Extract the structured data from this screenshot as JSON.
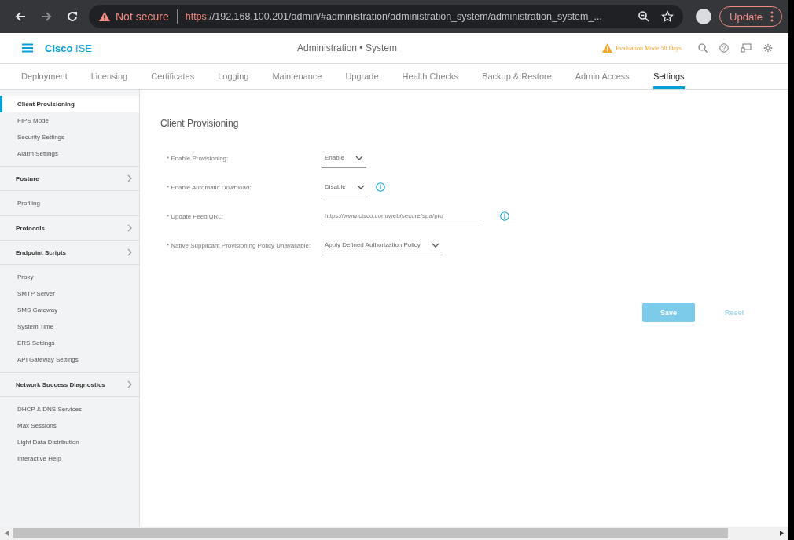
{
  "browser": {
    "security_label": "Not secure",
    "url_scheme": "https",
    "url_rest": "://192.168.100.201/admin/#administration/administration_system/administration_system_...",
    "update_label": "Update"
  },
  "header": {
    "brand_primary": "Cisco",
    "brand_secondary": "ISE",
    "title": "Administration • System",
    "evaluation": "Evaluation Mode 50 Days"
  },
  "tabs": [
    {
      "label": "Deployment",
      "selected": false
    },
    {
      "label": "Licensing",
      "selected": false
    },
    {
      "label": "Certificates",
      "selected": false
    },
    {
      "label": "Logging",
      "selected": false
    },
    {
      "label": "Maintenance",
      "selected": false
    },
    {
      "label": "Upgrade",
      "selected": false
    },
    {
      "label": "Health Checks",
      "selected": false
    },
    {
      "label": "Backup & Restore",
      "selected": false
    },
    {
      "label": "Admin Access",
      "selected": false
    },
    {
      "label": "Settings",
      "selected": true
    }
  ],
  "sidebar": {
    "items": [
      {
        "label": "Client Provisioning",
        "kind": "item",
        "selected": true
      },
      {
        "label": "FIPS Mode",
        "kind": "item",
        "selected": false
      },
      {
        "label": "Security Settings",
        "kind": "item",
        "selected": false
      },
      {
        "label": "Alarm Settings",
        "kind": "item",
        "selected": false
      },
      {
        "label": "Posture",
        "kind": "group",
        "selected": false
      },
      {
        "label": "Profiling",
        "kind": "item",
        "selected": false
      },
      {
        "label": "Protocols",
        "kind": "group",
        "selected": false
      },
      {
        "label": "Endpoint Scripts",
        "kind": "group",
        "selected": false
      },
      {
        "label": "Proxy",
        "kind": "item",
        "selected": false
      },
      {
        "label": "SMTP Server",
        "kind": "item",
        "selected": false
      },
      {
        "label": "SMS Gateway",
        "kind": "item",
        "selected": false
      },
      {
        "label": "System Time",
        "kind": "item",
        "selected": false
      },
      {
        "label": "ERS Settings",
        "kind": "item",
        "selected": false
      },
      {
        "label": "API Gateway Settings",
        "kind": "item",
        "selected": false
      },
      {
        "label": "Network Success Diagnostics",
        "kind": "group",
        "selected": false
      },
      {
        "label": "DHCP & DNS Services",
        "kind": "item",
        "selected": false
      },
      {
        "label": "Max Sessions",
        "kind": "item",
        "selected": false
      },
      {
        "label": "Light Data Distribution",
        "kind": "item",
        "selected": false
      },
      {
        "label": "Interactive Help",
        "kind": "item",
        "selected": false
      }
    ]
  },
  "form": {
    "title": "Client Provisioning",
    "fields": [
      {
        "label": "* Enable Provisioning:",
        "kind": "select",
        "value": "Enable",
        "info": false
      },
      {
        "label": "* Enable Automatic Download:",
        "kind": "select",
        "value": "Disable",
        "info": true
      },
      {
        "label": "* Update Feed URL:",
        "kind": "text",
        "value": "https://www.cisco.com/web/secure/spa/pro",
        "info": true
      },
      {
        "label": "* Native Supplicant Provisioning Policy Unavailable:",
        "kind": "select",
        "value": "Apply Defined Authorization Policy",
        "info": false
      }
    ],
    "actions": [
      {
        "label": "Save",
        "kind": "primary",
        "disabled": true
      },
      {
        "label": "Reset",
        "kind": "link",
        "disabled": true
      }
    ]
  }
}
